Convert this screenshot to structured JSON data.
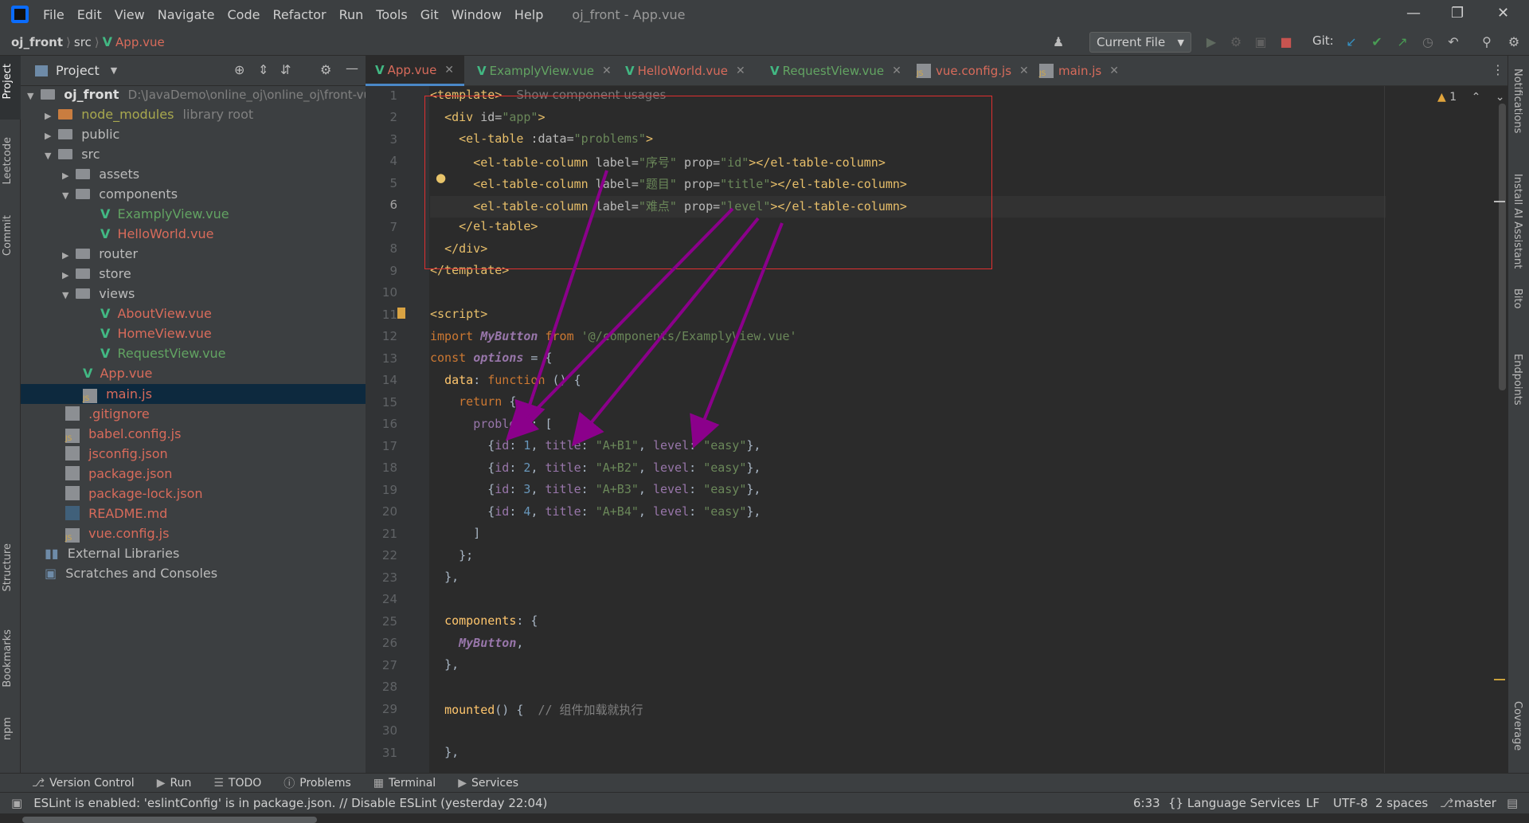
{
  "menubar": {
    "items": [
      "File",
      "Edit",
      "View",
      "Navigate",
      "Code",
      "Refactor",
      "Run",
      "Tools",
      "Git",
      "Window",
      "Help"
    ],
    "title": "oj_front - App.vue"
  },
  "navbar": {
    "crumbs": [
      "oj_front",
      "src",
      "App.vue"
    ],
    "run_config": "Current File",
    "git_label": "Git:"
  },
  "project": {
    "title": "Project",
    "root_name": "oj_front",
    "root_path": "D:\\JavaDemo\\online_oj\\online_oj\\front-vue",
    "rows": [
      {
        "label": "node_modules",
        "extra": "library root"
      },
      {
        "label": "public"
      },
      {
        "label": "src"
      },
      {
        "label": "assets"
      },
      {
        "label": "components"
      },
      {
        "label": "ExamplyView.vue"
      },
      {
        "label": "HelloWorld.vue"
      },
      {
        "label": "router"
      },
      {
        "label": "store"
      },
      {
        "label": "views"
      },
      {
        "label": "AboutView.vue"
      },
      {
        "label": "HomeView.vue"
      },
      {
        "label": "RequestView.vue"
      },
      {
        "label": "App.vue"
      },
      {
        "label": "main.js"
      },
      {
        "label": ".gitignore"
      },
      {
        "label": "babel.config.js"
      },
      {
        "label": "jsconfig.json"
      },
      {
        "label": "package.json"
      },
      {
        "label": "package-lock.json"
      },
      {
        "label": "README.md"
      },
      {
        "label": "vue.config.js"
      },
      {
        "label": "External Libraries"
      },
      {
        "label": "Scratches and Consoles"
      }
    ]
  },
  "left_strip": [
    "Project",
    "Leetcode",
    "Commit",
    "Structure",
    "Bookmarks",
    "npm"
  ],
  "right_strip": [
    "Notifications",
    "Install AI Assistant",
    "Bito",
    "Endpoints",
    "Coverage"
  ],
  "tabs": [
    {
      "label": "App.vue"
    },
    {
      "label": "ExamplyView.vue"
    },
    {
      "label": "HelloWorld.vue"
    },
    {
      "label": "RequestView.vue"
    },
    {
      "label": "vue.config.js"
    },
    {
      "label": "main.js"
    }
  ],
  "editor": {
    "warning_count": "1",
    "inlay_hint": "Show component usages",
    "line_numbers": [
      "1",
      "2",
      "3",
      "4",
      "5",
      "6",
      "7",
      "8",
      "9",
      "10",
      "11",
      "12",
      "13",
      "14",
      "15",
      "16",
      "17",
      "18",
      "19",
      "20",
      "21",
      "22",
      "23",
      "24",
      "25",
      "26",
      "27",
      "28",
      "29",
      "30",
      "31"
    ],
    "code": {
      "l1_tag": "<template>",
      "l2_open": "<div ",
      "l2_attr": "id=",
      "l2_val": "\"app\"",
      "l2_close": ">",
      "l3_open": "<el-table ",
      "l3_attr": ":data=",
      "l3_val": "\"problems\"",
      "l3_close": ">",
      "col_open": "<el-table-column ",
      "label_attr": "label=",
      "prop_attr": " prop=",
      "col_close": "></el-table-column>",
      "l4_label": "\"序号\"",
      "l4_prop": "\"id\"",
      "l5_label": "\"题目\"",
      "l5_prop": "\"title\"",
      "l6_label": "\"难点\"",
      "l6_prop": "\"level\"",
      "l7": "</el-table>",
      "l8": "</div>",
      "l9": "</template>",
      "l11": "<script>",
      "l12_import": "import ",
      "l12_name": "MyButton",
      "l12_from": " from ",
      "l12_path": "'@/components/ExamplyView.vue'",
      "l13_const": "const ",
      "l13_name": "options",
      "l13_rest": " = {",
      "l14_data": "data",
      "l14_colon": ": ",
      "l14_fn": "function",
      "l14_rest": " () {",
      "l15_return": "return",
      "l15_rest": " {",
      "l16_prob": "problems",
      "l16_rest": ": [",
      "row_open": "{",
      "k_id": "id",
      "k_title": "title",
      "k_level": "level",
      "colon": ": ",
      "comma": ", ",
      "row_close": "},",
      "r1_id": "1",
      "r1_title": "\"A+B1\"",
      "r1_level": "\"easy\"",
      "r2_id": "2",
      "r2_title": "\"A+B2\"",
      "r2_level": "\"easy\"",
      "r3_id": "3",
      "r3_title": "\"A+B3\"",
      "r3_level": "\"easy\"",
      "r4_id": "4",
      "r4_title": "\"A+B4\"",
      "r4_level": "\"easy\"",
      "l21": "]",
      "l22": "};",
      "l23": "},",
      "l25_key": "components",
      "l25_rest": ": {",
      "l26_name": "MyButton",
      "l26_rest": ",",
      "l27": "},",
      "l29_fn": "mounted",
      "l29_rest": "() {  ",
      "l29_cmt": "// 组件加载就执行",
      "l31": "},"
    }
  },
  "bottom_tabs": [
    "Version Control",
    "Run",
    "TODO",
    "Problems",
    "Terminal",
    "Services"
  ],
  "status": {
    "message": "ESLint is enabled: 'eslintConfig' is in package.json. // Disable ESLint (yesterday 22:04)",
    "position": "6:33",
    "lang_services": "{} Language Services",
    "line_sep": "LF",
    "encoding": "UTF-8",
    "indent": "2 spaces",
    "branch": "master"
  },
  "colors": {
    "accent": "#4a88c7",
    "annotation_box": "#e03030",
    "annotation_arrows": "#8b008b"
  }
}
